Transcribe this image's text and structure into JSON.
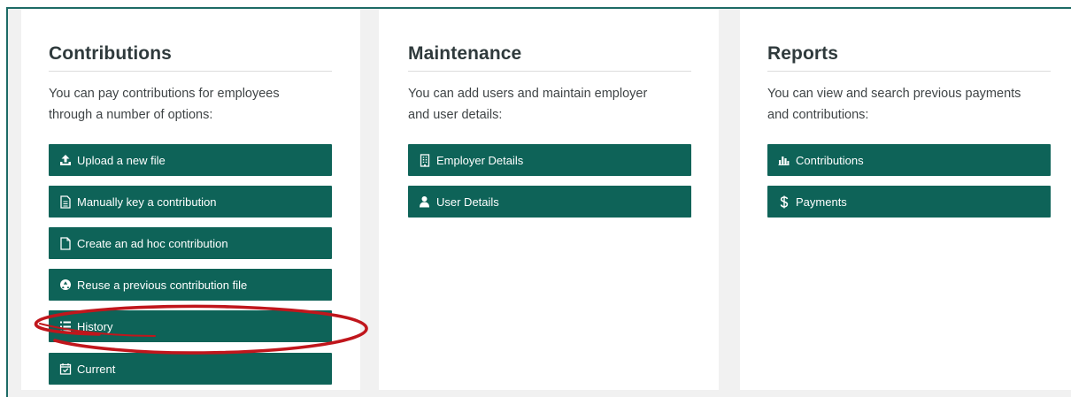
{
  "colors": {
    "accent": "#0e6358",
    "frame_border": "#1d6b66",
    "annotation": "#c0161c"
  },
  "contributions": {
    "title": "Contributions",
    "description_line1": "You can pay contributions for employees",
    "description_line2": "through a number of options:",
    "buttons": [
      {
        "label": "Upload a new file",
        "icon": "upload-icon"
      },
      {
        "label": "Manually key a contribution",
        "icon": "document-lines-icon"
      },
      {
        "label": "Create an ad hoc contribution",
        "icon": "blank-document-icon"
      },
      {
        "label": "Reuse a previous contribution file",
        "icon": "recycle-icon"
      },
      {
        "label": "History",
        "icon": "list-icon"
      },
      {
        "label": "Current",
        "icon": "calendar-check-icon"
      }
    ]
  },
  "maintenance": {
    "title": "Maintenance",
    "description_line1": "You can add users and maintain employer",
    "description_line2": "and user details:",
    "buttons": [
      {
        "label": "Employer Details",
        "icon": "building-icon"
      },
      {
        "label": "User Details",
        "icon": "user-icon"
      }
    ]
  },
  "reports": {
    "title": "Reports",
    "description_line1": "You can view and search previous payments",
    "description_line2": "and contributions:",
    "buttons": [
      {
        "label": "Contributions",
        "icon": "bar-chart-icon"
      },
      {
        "label": "Payments",
        "icon": "dollar-icon"
      }
    ]
  },
  "annotation": {
    "shape": "hand-drawn-ellipse",
    "highlights": "History"
  }
}
